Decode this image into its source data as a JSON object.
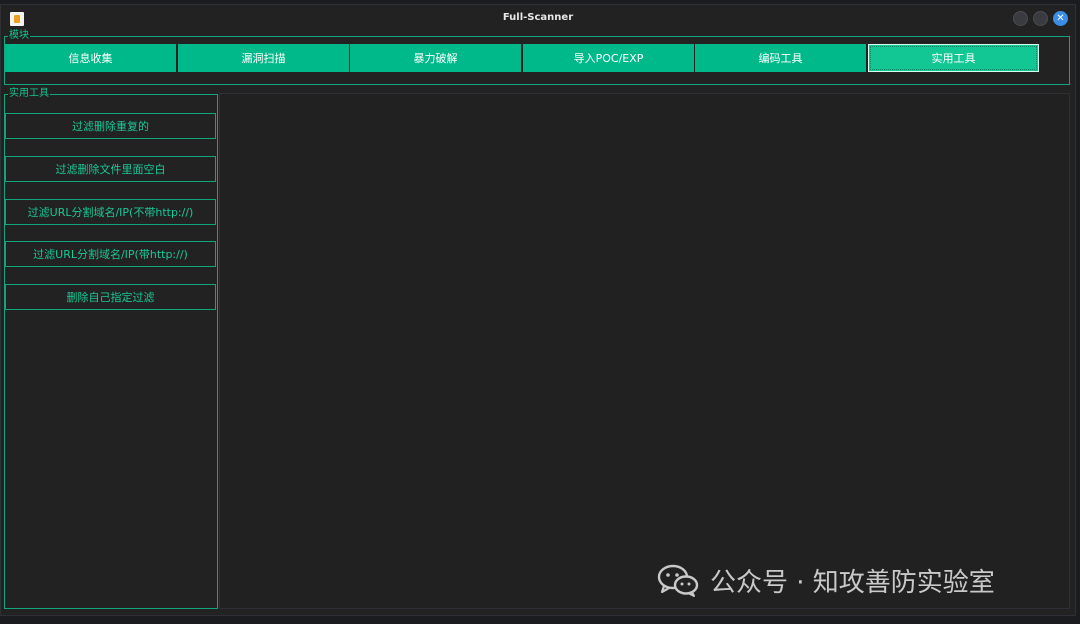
{
  "window": {
    "title": "Full-Scanner"
  },
  "modules": {
    "legend": "模块",
    "buttons": [
      {
        "label": "信息收集"
      },
      {
        "label": "漏洞扫描"
      },
      {
        "label": "暴力破解"
      },
      {
        "label": "导入POC/EXP"
      },
      {
        "label": "编码工具"
      },
      {
        "label": "实用工具",
        "active": true
      }
    ]
  },
  "tools": {
    "legend": "实用工具",
    "buttons": [
      {
        "label": "过滤删除重复的"
      },
      {
        "label": "过滤删除文件里面空白"
      },
      {
        "label": "过滤URL分割域名/IP(不带http://)"
      },
      {
        "label": "过滤URL分割域名/IP(带http://)"
      },
      {
        "label": "删除自己指定过滤"
      }
    ]
  },
  "watermark": {
    "text": "公众号 · 知攻善防实验室",
    "icon": "wechat-icon"
  },
  "colors": {
    "accent": "#00b98a",
    "accent_text": "#19c894",
    "window_bg": "#222222"
  }
}
